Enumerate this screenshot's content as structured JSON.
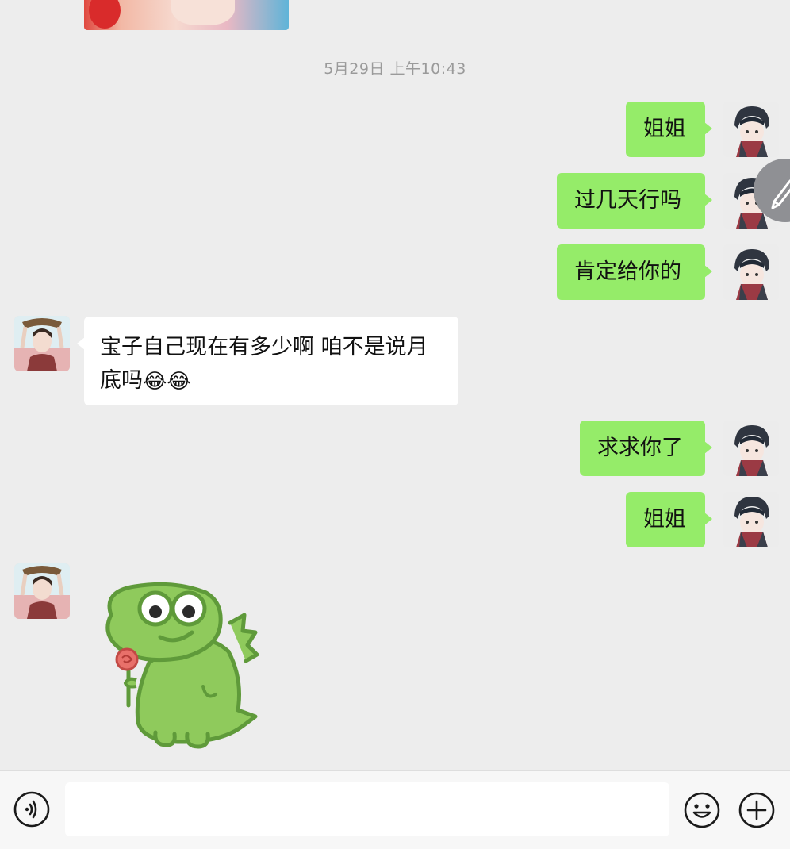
{
  "chat": {
    "timestamp": "5月29日 上午10:43",
    "messages": [
      {
        "id": "msg-1",
        "side": "right",
        "text": "姐姐"
      },
      {
        "id": "msg-2",
        "side": "right",
        "text": "过几天行吗"
      },
      {
        "id": "msg-3",
        "side": "right",
        "text": "肯定给你的"
      },
      {
        "id": "msg-4",
        "side": "left",
        "text": "宝子自己现在有多少啊 咱不是说月底吗",
        "emoji": "😂😂"
      },
      {
        "id": "msg-5",
        "side": "right",
        "text": "求求你了"
      },
      {
        "id": "msg-6",
        "side": "right",
        "text": "姐姐"
      },
      {
        "id": "msg-7",
        "side": "left",
        "sticker": "green-dinosaur-holding-rose-sticker"
      }
    ]
  },
  "input_bar": {
    "input_value": "",
    "voice_icon": "voice-icon",
    "emoji_icon": "emoji-icon",
    "plus_icon": "plus-icon"
  },
  "colors": {
    "background": "#ededed",
    "sent_bubble": "#95ec69",
    "received_bubble": "#ffffff",
    "timestamp_text": "#9a9a9a",
    "sticker_green": "#8fca5c"
  }
}
